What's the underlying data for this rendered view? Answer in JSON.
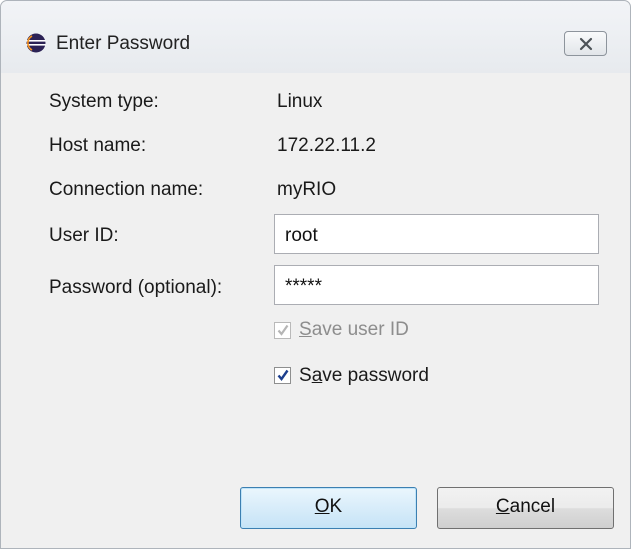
{
  "window": {
    "title": "Enter Password",
    "icon": "eclipse-icon",
    "close_icon": "close-icon"
  },
  "fields": {
    "system_type_label": "System type:",
    "system_type_value": "Linux",
    "host_name_label": "Host name:",
    "host_name_value": "172.22.11.2",
    "connection_name_label": "Connection name:",
    "connection_name_value": "myRIO",
    "user_id_label": "User ID:",
    "user_id_value": "root",
    "password_label": "Password (optional):",
    "password_value": "*****"
  },
  "options": {
    "save_user_id": {
      "label_mnemonic": "S",
      "label_rest": "ave user ID",
      "checked": true,
      "disabled": true
    },
    "save_password": {
      "label_pre": "S",
      "label_mnemonic": "a",
      "label_rest": "ve password",
      "checked": true,
      "disabled": false
    }
  },
  "buttons": {
    "ok_mnemonic": "O",
    "ok_rest": "K",
    "cancel_mnemonic": "C",
    "cancel_rest": "ancel"
  },
  "colors": {
    "dialog_bg": "#f0f0f0",
    "check_blue": "#1d3f8e",
    "check_disabled": "#b5b5b5",
    "ok_border": "#3c7fb1"
  }
}
